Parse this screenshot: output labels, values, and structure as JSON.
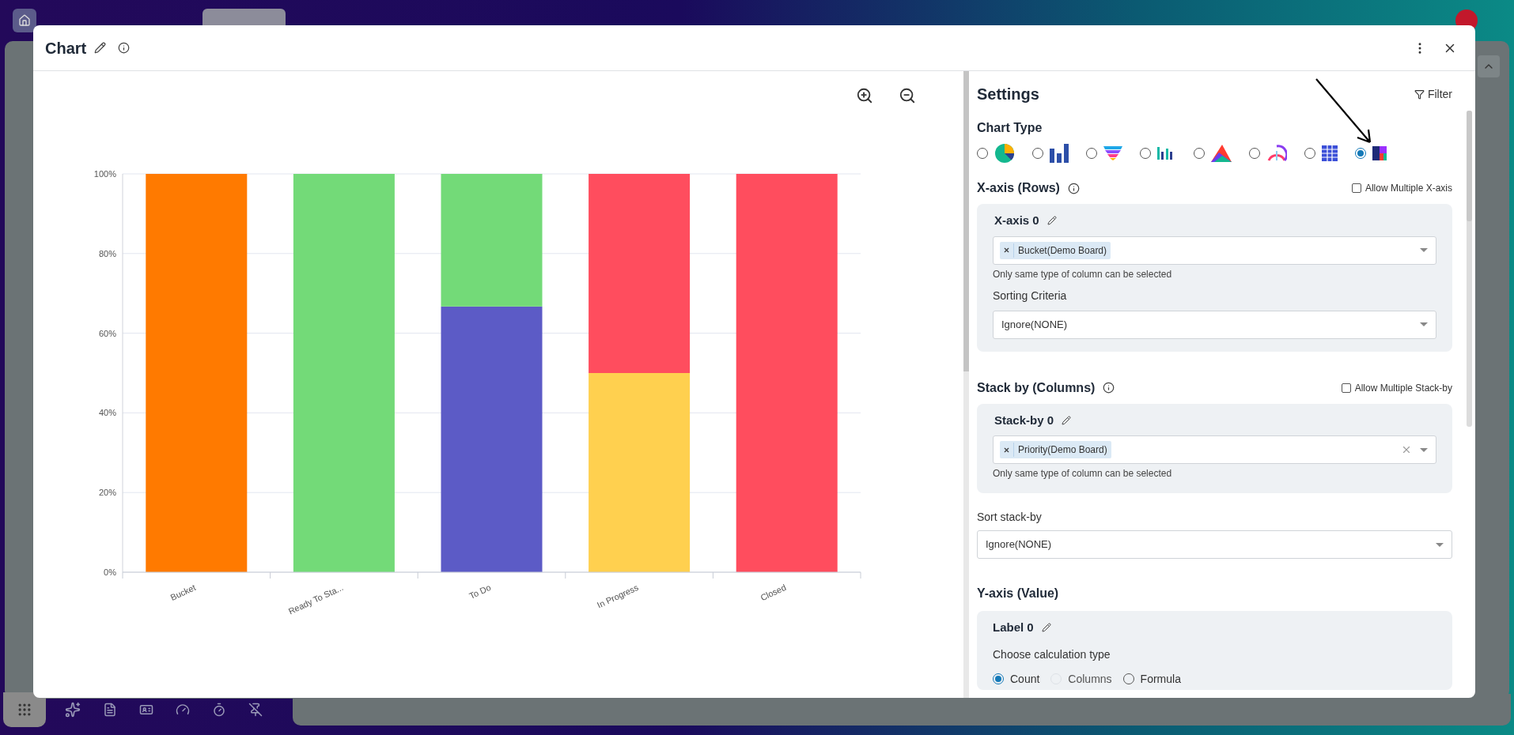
{
  "modal": {
    "title": "Chart"
  },
  "chart_data": {
    "type": "bar",
    "stacked": true,
    "grid": true,
    "categories": [
      "Bucket",
      "Ready To Sta...",
      "To Do",
      "In Progress",
      "Closed"
    ],
    "series": [
      {
        "color": "#ff7a00",
        "values": [
          100,
          0,
          0,
          0,
          0
        ]
      },
      {
        "color": "#5c5bc6",
        "values": [
          0,
          0,
          66.7,
          0,
          0
        ]
      },
      {
        "color": "#ffd04f",
        "values": [
          0,
          0,
          0,
          50,
          0
        ]
      },
      {
        "color": "#73da78",
        "values": [
          0,
          100,
          33.3,
          0,
          0
        ]
      },
      {
        "color": "#ff4d5e",
        "values": [
          0,
          0,
          0,
          50,
          100
        ]
      }
    ],
    "ylim": [
      0,
      100
    ],
    "yticks": [
      {
        "value": 0,
        "label": "0%"
      },
      {
        "value": 20,
        "label": "20%"
      },
      {
        "value": 40,
        "label": "40%"
      },
      {
        "value": 60,
        "label": "60%"
      },
      {
        "value": 80,
        "label": "80%"
      },
      {
        "value": 100,
        "label": "100%"
      }
    ]
  },
  "settings": {
    "title": "Settings",
    "filter_label": "Filter",
    "chart_type_label": "Chart Type",
    "chart_types": [
      {
        "kind": "pie",
        "selected": false
      },
      {
        "kind": "bar",
        "selected": false
      },
      {
        "kind": "funnel",
        "selected": false
      },
      {
        "kind": "columns",
        "selected": false
      },
      {
        "kind": "area",
        "selected": false
      },
      {
        "kind": "gauge",
        "selected": false
      },
      {
        "kind": "table",
        "selected": false
      },
      {
        "kind": "treemap",
        "selected": true
      }
    ],
    "x_axis": {
      "title": "X-axis (Rows)",
      "allow_multiple": {
        "label": "Allow Multiple X-axis",
        "checked": false
      },
      "items": [
        {
          "title": "X-axis 0",
          "tags": [
            "Bucket(Demo Board)"
          ],
          "clearable": false,
          "hint": "Only same type of column can be selected",
          "sorting_label": "Sorting Criteria",
          "sorting_value": "Ignore(NONE)"
        }
      ]
    },
    "stack_by": {
      "title": "Stack by (Columns)",
      "allow_multiple": {
        "label": "Allow Multiple Stack-by",
        "checked": false
      },
      "items": [
        {
          "title": "Stack-by 0",
          "tags": [
            "Priority(Demo Board)"
          ],
          "clearable": true,
          "hint": "Only same type of column can be selected"
        }
      ],
      "sort_label": "Sort stack-by",
      "sort_value": "Ignore(NONE)"
    },
    "y_axis": {
      "title": "Y-axis (Value)",
      "items": [
        {
          "title": "Label 0",
          "calc_label": "Choose calculation type",
          "calc_options": [
            {
              "label": "Count",
              "selected": true,
              "disabled": false
            },
            {
              "label": "Columns",
              "selected": false,
              "disabled": true
            },
            {
              "label": "Formula",
              "selected": false,
              "disabled": false
            }
          ]
        }
      ]
    }
  }
}
